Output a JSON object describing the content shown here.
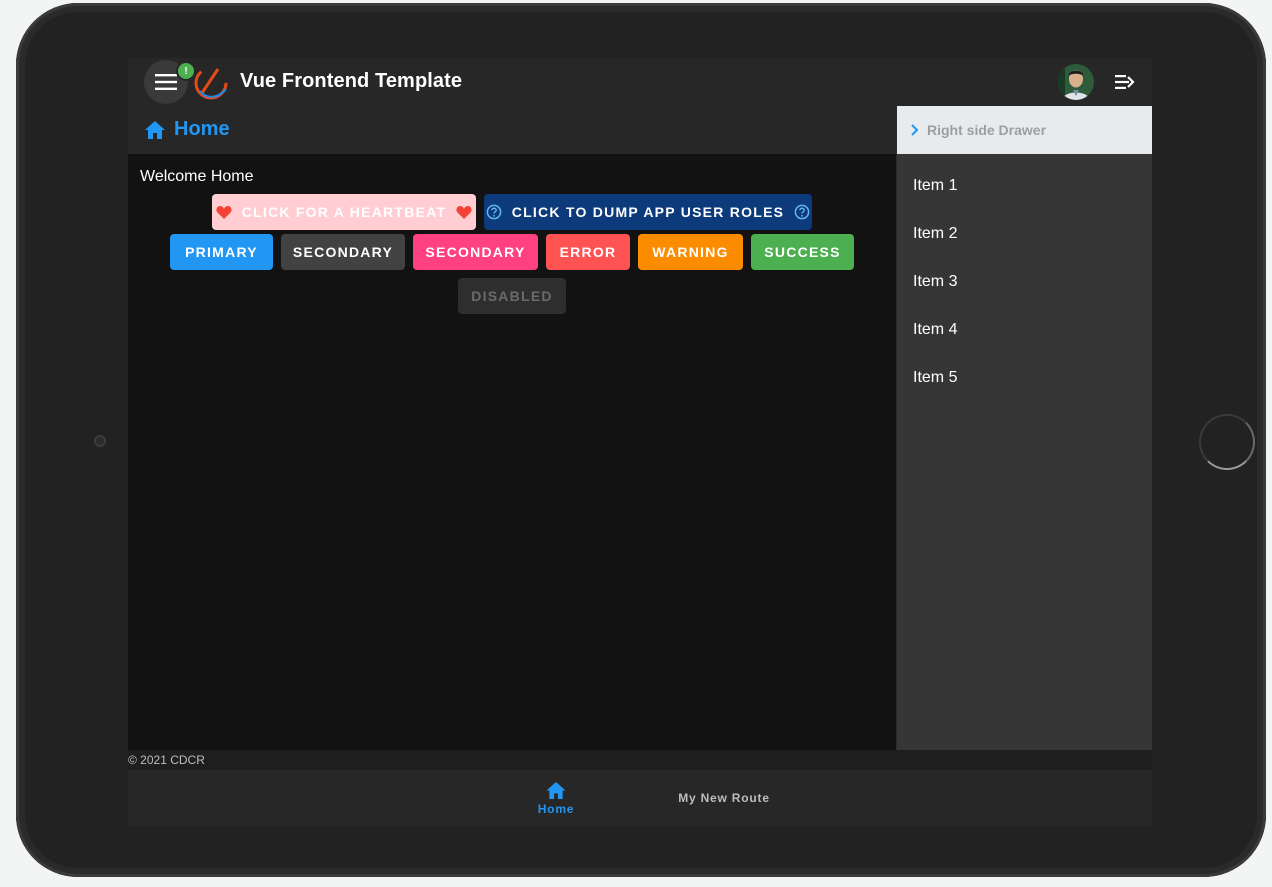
{
  "app": {
    "title": "Vue Frontend Template",
    "notification_badge": "!",
    "accent_color": "#2196f3"
  },
  "page": {
    "title": "Home",
    "welcome": "Welcome Home"
  },
  "buttons": {
    "heartbeat": "Click for a heartbeat",
    "dump_roles": "Click to dump app user roles",
    "primary": "Primary",
    "secondary_dark": "Secondary",
    "secondary_pink": "Secondary",
    "error": "Error",
    "warning": "Warning",
    "success": "Success",
    "disabled": "Disabled"
  },
  "button_colors": {
    "heartbeat_bg": "#ffcdd2",
    "dump_roles_bg": "#0d3a7a",
    "primary": "#2196f3",
    "secondary_dark": "#424242",
    "secondary_pink": "#ff4081",
    "error": "#ff5252",
    "warning": "#fb8c00",
    "success": "#4caf50",
    "disabled_bg": "#2e2e2e"
  },
  "right_drawer": {
    "title": "Right side Drawer",
    "items": [
      {
        "label": "Item 1"
      },
      {
        "label": "Item 2"
      },
      {
        "label": "Item 3"
      },
      {
        "label": "Item 4"
      },
      {
        "label": "Item 5"
      }
    ]
  },
  "footer": {
    "copyright": "© 2021 CDCR"
  },
  "bottom_nav": {
    "items": [
      {
        "label": "Home",
        "icon": "home-icon",
        "active": true
      },
      {
        "label": "My New Route",
        "active": false
      }
    ]
  }
}
